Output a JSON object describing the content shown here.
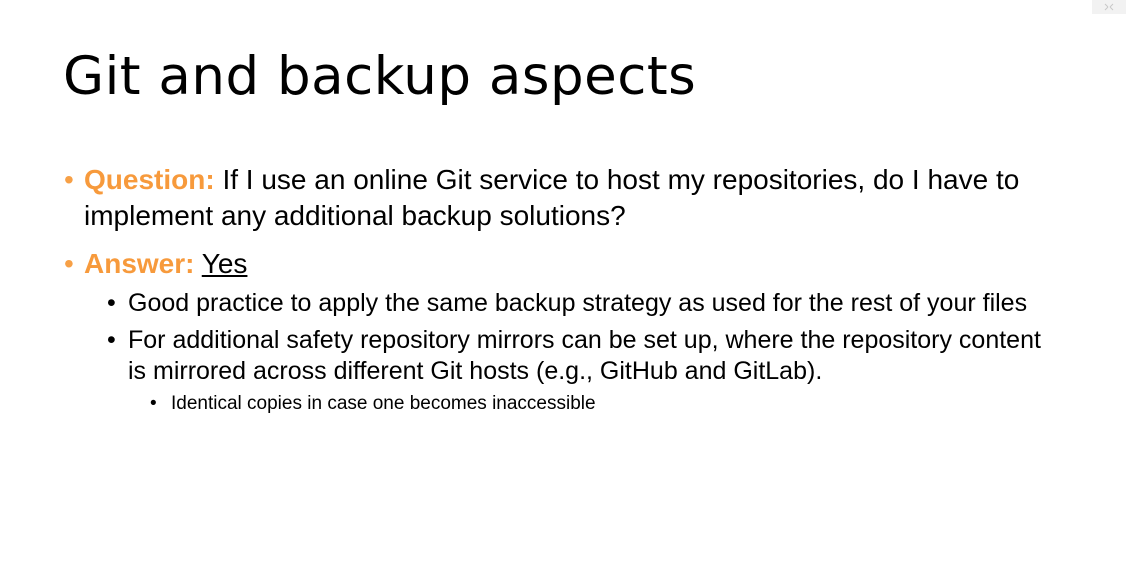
{
  "slide": {
    "title": "Git and backup aspects",
    "items": [
      {
        "label": "Question:",
        "text": " If I use an online Git service to host my repositories, do I have to implement any additional backup solutions?"
      },
      {
        "label": "Answer:",
        "answer_value": "Yes",
        "subitems": [
          {
            "text": "Good practice to apply the same backup strategy as used for the rest of your files"
          },
          {
            "text": "For additional safety repository mirrors can be set up, where the repository content is mirrored across different Git hosts (e.g., GitHub and GitLab).",
            "subitems": [
              {
                "text": "Identical copies in case one becomes inaccessible"
              }
            ]
          }
        ]
      }
    ]
  },
  "colors": {
    "accent": "#f79a3c",
    "background": "#ffffff",
    "text": "#000000"
  },
  "icons": {
    "corner": "expand-icon"
  }
}
